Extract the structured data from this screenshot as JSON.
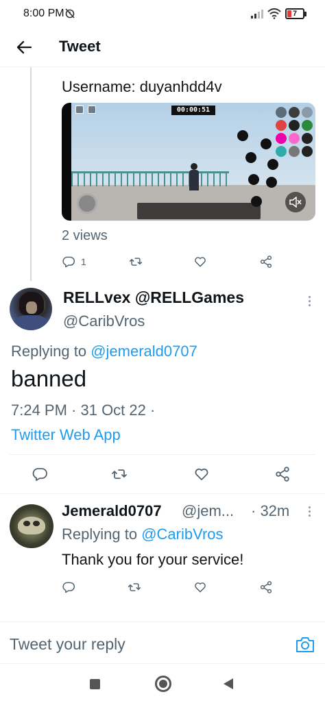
{
  "status_bar": {
    "time": "8:00 PM",
    "battery": "7"
  },
  "header": {
    "title": "Tweet"
  },
  "parent_tweet": {
    "text": "Username: duyanhdd4v",
    "video": {
      "timer": "00:00:51"
    },
    "views": "2 views",
    "actions": {
      "reply_count": "1"
    }
  },
  "main_tweet": {
    "display_name": "RELLvex @RELLGames",
    "handle": "@CaribVros",
    "replying_to_label": "Replying to",
    "replying_to_handle": "@jemerald0707",
    "text": "banned",
    "timestamp": "7:24 PM · 31 Oct 22 ·",
    "source": "Twitter Web App"
  },
  "reply_tweet": {
    "display_name": "Jemerald0707",
    "handle": "@jem...",
    "time": "· 32m",
    "replying_to_label": "Replying to",
    "replying_to_handle": "@CaribVros",
    "text": "Thank you for your service!"
  },
  "composer": {
    "placeholder": "Tweet your reply"
  },
  "colors": {
    "link": "#1d9bf0",
    "secondary_text": "#536471",
    "primary_text": "#0f1419"
  },
  "icons": [
    "back-arrow-icon",
    "reply-icon",
    "retweet-icon",
    "like-icon",
    "share-icon",
    "more-icon",
    "camera-icon",
    "mute-icon"
  ]
}
